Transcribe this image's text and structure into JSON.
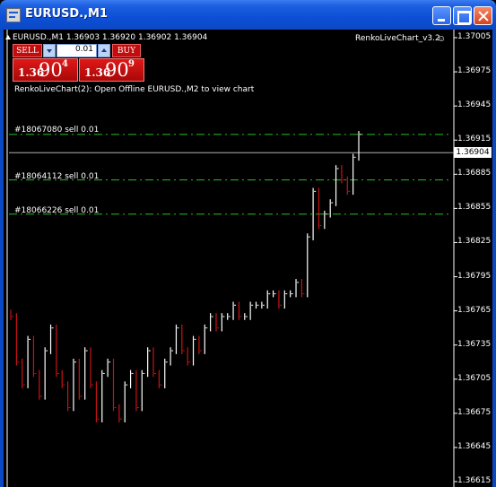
{
  "window": {
    "title": "EURUSD.,M1"
  },
  "chart_header": {
    "symbol_line": "EURUSD.,M1  1.36903 1.36920 1.36902 1.36904",
    "indicator_label": "RenkoLiveChart_v3.2",
    "info_line": "RenkoLiveChart(2): Open Offline EURUSD.,M2 to view chart"
  },
  "trade_panel": {
    "sell_label": "SELL",
    "buy_label": "BUY",
    "lot_value": "0.01",
    "sell_price": {
      "small": "1.36",
      "big": "90",
      "sup": "4"
    },
    "buy_price": {
      "small": "1.36",
      "big": "90",
      "sup": "9"
    }
  },
  "orders": [
    {
      "label": "#18067080 sell 0.01",
      "price": 1.3692
    },
    {
      "label": "#18064112 sell 0.01",
      "price": 1.3688
    },
    {
      "label": "#18066226 sell 0.01",
      "price": 1.3685
    }
  ],
  "current_price": "1.36904",
  "colors": {
    "background": "#000000",
    "candle_up": "#ffffff",
    "candle_down": "#c81414",
    "order_line": "#22c322",
    "grid_axis": "#ffffff"
  },
  "chart_data": {
    "type": "line",
    "title": "",
    "xlabel": "",
    "ylabel": "",
    "ylim": [
      1.36615,
      1.37005
    ],
    "y_ticks": [
      "1.37005",
      "1.36975",
      "1.36945",
      "1.36915",
      "1.36885",
      "1.36855",
      "1.36825",
      "1.36795",
      "1.36765",
      "1.36735",
      "1.36705",
      "1.36675",
      "1.36645",
      "1.36615"
    ],
    "series": [
      {
        "values": [
          1.3676,
          1.3672,
          1.367,
          1.3674,
          1.3671,
          1.3669,
          1.3673,
          1.3675,
          1.3671,
          1.367,
          1.3668,
          1.3672,
          1.3669,
          1.3673,
          1.367,
          1.3667,
          1.3671,
          1.3672,
          1.3668,
          1.3667,
          1.367,
          1.3671,
          1.3668,
          1.3671,
          1.3673,
          1.3671,
          1.367,
          1.3672,
          1.3673,
          1.3675,
          1.3673,
          1.3672,
          1.3674,
          1.3673,
          1.3675,
          1.3676,
          1.3675,
          1.3676,
          1.3676,
          1.3677,
          1.3676,
          1.3676,
          1.3677,
          1.3677,
          1.3677,
          1.3678,
          1.3678,
          1.3677,
          1.3678,
          1.3678,
          1.3679,
          1.3678,
          1.3683,
          1.3687,
          1.3684,
          1.3685,
          1.3686,
          1.3689,
          1.3688,
          1.3687,
          1.369,
          1.3692
        ]
      }
    ]
  }
}
